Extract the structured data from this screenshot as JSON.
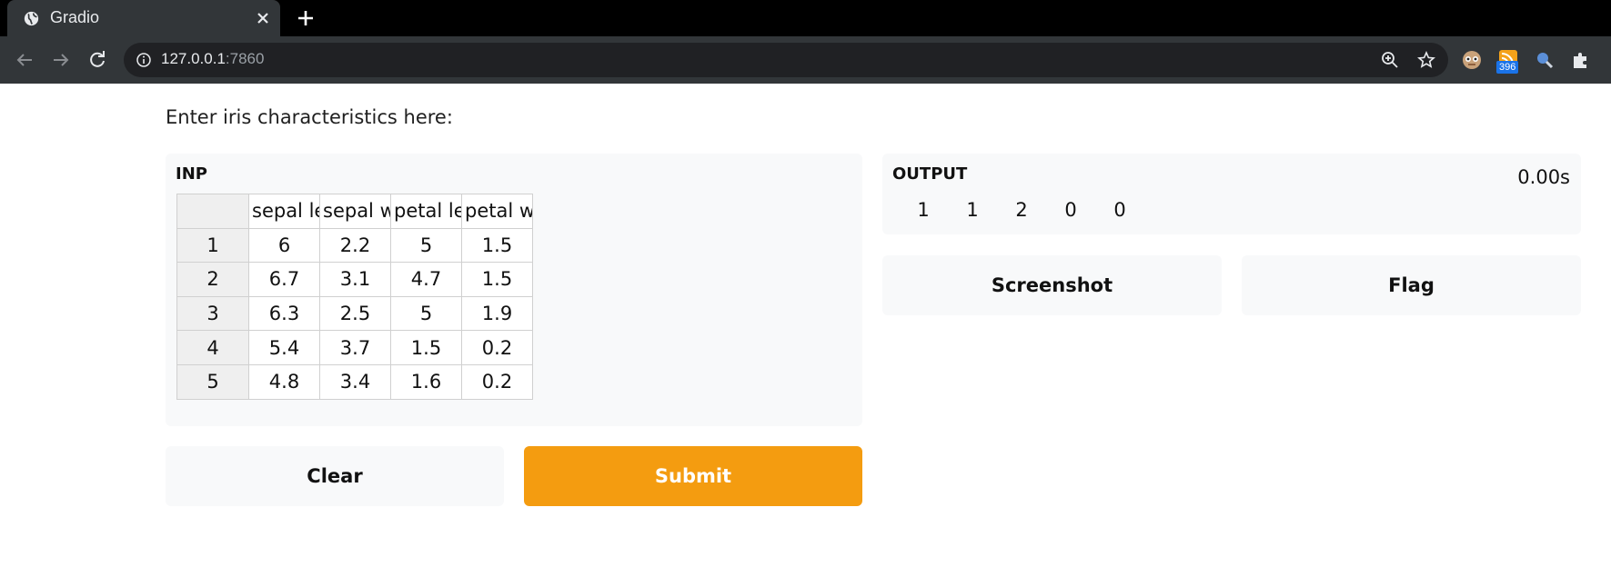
{
  "browser": {
    "tab_title": "Gradio",
    "url_host": "127.0.0.1",
    "url_port": ":7860",
    "extension_badge": "396"
  },
  "page": {
    "description": "Enter iris characteristics here:"
  },
  "input_panel": {
    "label": "INP",
    "columns": [
      "sepal le",
      "sepal w",
      "petal le",
      "petal w"
    ],
    "rows": [
      {
        "index": "1",
        "cells": [
          "6",
          "2.2",
          "5",
          "1.5"
        ]
      },
      {
        "index": "2",
        "cells": [
          "6.7",
          "3.1",
          "4.7",
          "1.5"
        ]
      },
      {
        "index": "3",
        "cells": [
          "6.3",
          "2.5",
          "5",
          "1.9"
        ]
      },
      {
        "index": "4",
        "cells": [
          "5.4",
          "3.7",
          "1.5",
          "0.2"
        ]
      },
      {
        "index": "5",
        "cells": [
          "4.8",
          "3.4",
          "1.6",
          "0.2"
        ]
      }
    ]
  },
  "output_panel": {
    "label": "OUTPUT",
    "timer": "0.00s",
    "values": [
      "1",
      "1",
      "2",
      "0",
      "0"
    ]
  },
  "buttons": {
    "clear": "Clear",
    "submit": "Submit",
    "screenshot": "Screenshot",
    "flag": "Flag"
  },
  "colors": {
    "accent": "#f49c10",
    "panel_bg": "#f8f9fa",
    "chrome_bg": "#323639"
  }
}
